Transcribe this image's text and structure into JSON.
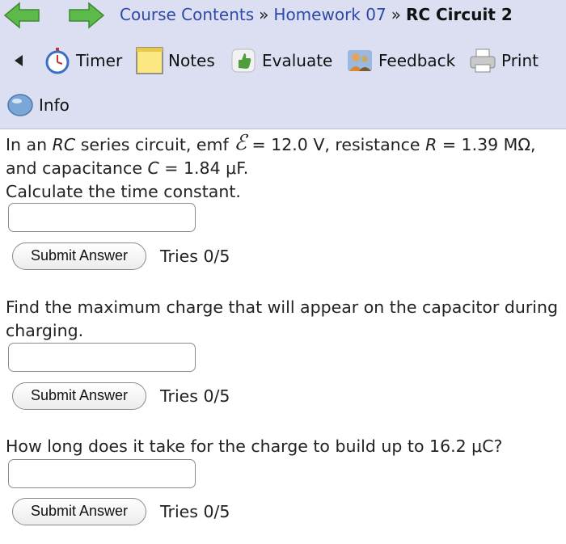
{
  "navigation": {
    "back_icon": "green-left-arrow-icon",
    "forward_icon": "green-right-arrow-icon",
    "breadcrumb": [
      "Course Contents",
      "Homework 07",
      "RC Circuit 2"
    ],
    "separator": "»"
  },
  "toolbar": {
    "timer": "Timer",
    "notes": "Notes",
    "evaluate": "Evaluate",
    "feedback": "Feedback",
    "print": "Print",
    "info": "Info"
  },
  "problem": {
    "intro_1": "In an ",
    "rc": "RC",
    "intro_2": " series circuit, emf ",
    "emf_symbol": "ℰ",
    "intro_3": " = 12.0 V, resistance ",
    "r_symbol": "R",
    "intro_4": " = 1.39 MΩ, and capacitance ",
    "c_symbol": "C",
    "intro_5": " = 1.84 μF.",
    "q1": "Calculate the time constant.",
    "q2": "Find the maximum charge that will appear on the capacitor during charging.",
    "q3": "How long does it take for the charge to build up to 16.2 μC?"
  },
  "answers": [
    {
      "value": "",
      "submit_label": "Submit Answer",
      "tries": "Tries 0/5"
    },
    {
      "value": "",
      "submit_label": "Submit Answer",
      "tries": "Tries 0/5"
    },
    {
      "value": "",
      "submit_label": "Submit Answer",
      "tries": "Tries 0/5"
    }
  ],
  "colors": {
    "header_bg": "#dcdff2",
    "link": "#2d4aa6",
    "arrow_green": "#5cb94a"
  }
}
